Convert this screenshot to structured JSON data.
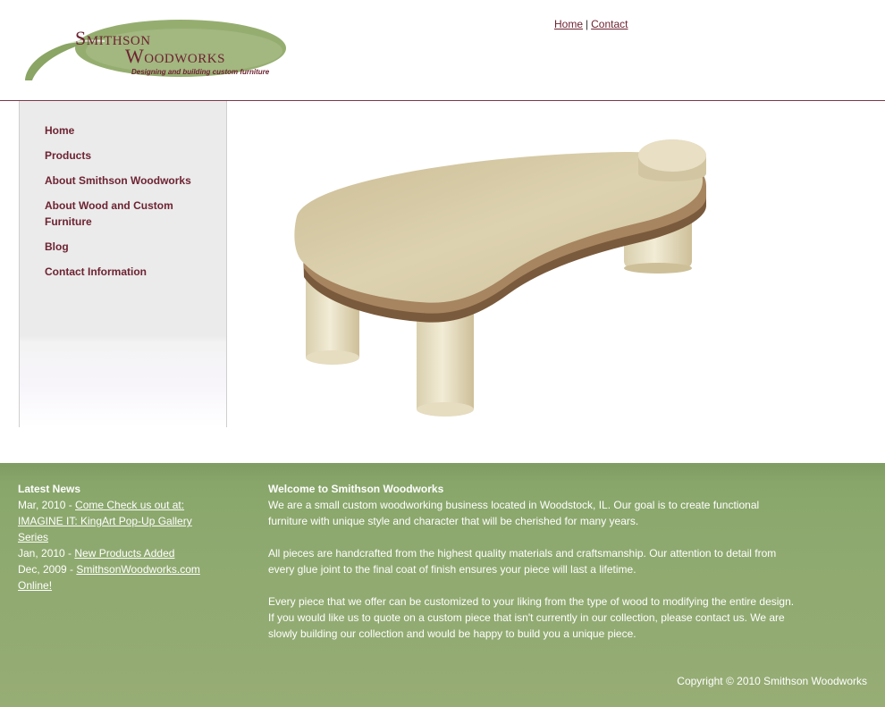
{
  "logo": {
    "word1": "Smithson",
    "word2": "Woodworks",
    "tagline": "Designing and building custom furniture"
  },
  "top_nav": {
    "home": "Home",
    "separator": "|",
    "contact": "Contact"
  },
  "sidebar": {
    "items": [
      {
        "label": "Home"
      },
      {
        "label": "Products"
      },
      {
        "label": "About Smithson Woodworks"
      },
      {
        "label": "About Wood and Custom Furniture"
      },
      {
        "label": "Blog"
      },
      {
        "label": "Contact Information"
      }
    ]
  },
  "news": {
    "heading": "Latest News",
    "items": [
      {
        "date": "Mar, 2010 - ",
        "link": "Come Check us out at: IMAGINE IT: KingArt Pop-Up Gallery Series"
      },
      {
        "date": "Jan, 2010 - ",
        "link": "New Products Added"
      },
      {
        "date": "Dec, 2009 - ",
        "link": "SmithsonWoodworks.com Online!"
      }
    ]
  },
  "welcome": {
    "heading": "Welcome to Smithson Woodworks",
    "paragraphs": [
      "We are a small custom woodworking business located in Woodstock, IL. Our goal is to create functional furniture with unique style and character that will be cherished for many years.",
      "All pieces are handcrafted from the highest quality materials and craftsmanship.  Our attention to detail from every glue joint to the final coat of finish ensures your piece will last a lifetime.",
      "Every piece that we offer can be customized to your liking from the type of wood to modifying the entire design.  If you would like us to quote on a custom piece that isn't currently in our collection, please contact us. We are slowly building our collection and would be happy to build you a unique piece."
    ]
  },
  "copyright": "Copyright © 2010 Smithson Woodworks",
  "colors": {
    "brand": "#6d2332",
    "logo_swoosh": "#8aa564",
    "footer_green": "#8ea96f"
  }
}
